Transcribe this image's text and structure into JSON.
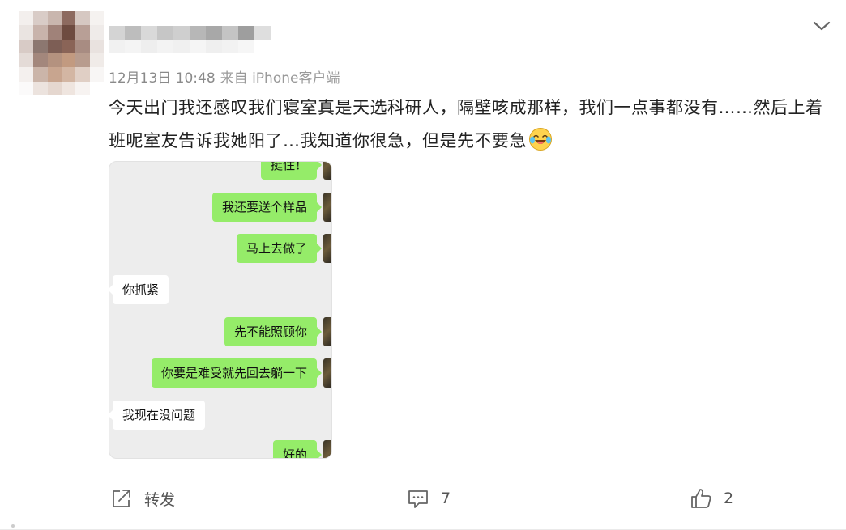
{
  "post": {
    "time": "12月13日 10:48",
    "source": "来自 iPhone客户端",
    "text": "今天出门我还感叹我们寝室真是天选科研人，隔壁咳成那样，我们一点事都没有……然后上着班呢室友告诉我她阳了…我知道你很急，但是先不要急",
    "emoji": "laugh-cry-emoji"
  },
  "chat_image": {
    "messages": [
      {
        "side": "right",
        "text": "挺住！"
      },
      {
        "side": "right",
        "text": "我还要送个样品"
      },
      {
        "side": "right",
        "text": "马上去做了"
      },
      {
        "side": "left",
        "text": "你抓紧"
      },
      {
        "side": "right",
        "text": "先不能照顾你"
      },
      {
        "side": "right",
        "text": "你要是难受就先回去躺一下"
      },
      {
        "side": "left",
        "text": "我现在没问题"
      },
      {
        "side": "right",
        "text": "好的"
      }
    ]
  },
  "actions": {
    "forward_label": "转发",
    "comment_count": "7",
    "like_count": "2"
  },
  "icons": {
    "forward": "share-icon",
    "comment": "comment-icon",
    "like": "thumbs-up-icon",
    "menu": "chevron-down-icon"
  },
  "colors": {
    "bubble_right": "#95ec69",
    "bubble_left": "#ffffff",
    "chat_bg": "#ededed"
  }
}
